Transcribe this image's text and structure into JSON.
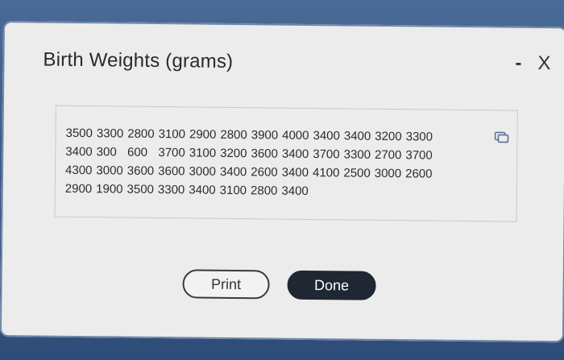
{
  "dialog": {
    "title": "Birth Weights (grams)",
    "minimize_label": "-",
    "close_label": "X"
  },
  "data_box": {
    "rows": [
      [
        "3500",
        "3300",
        "2800",
        "3100",
        "2900",
        "2800",
        "3900",
        "4000",
        "3400",
        "3400",
        "3200",
        "3300"
      ],
      [
        "3400",
        "300",
        "600",
        "3700",
        "3100",
        "3200",
        "3600",
        "3400",
        "3700",
        "3300",
        "2700",
        "3700"
      ],
      [
        "4300",
        "3000",
        "3600",
        "3600",
        "3000",
        "3400",
        "2600",
        "3400",
        "4100",
        "2500",
        "3000",
        "2600"
      ],
      [
        "2900",
        "1900",
        "3500",
        "3300",
        "3400",
        "3100",
        "2800",
        "3400",
        "",
        "",
        "",
        ""
      ]
    ],
    "copy_icon": "copy-icon"
  },
  "buttons": {
    "print_label": "Print",
    "done_label": "Done"
  }
}
